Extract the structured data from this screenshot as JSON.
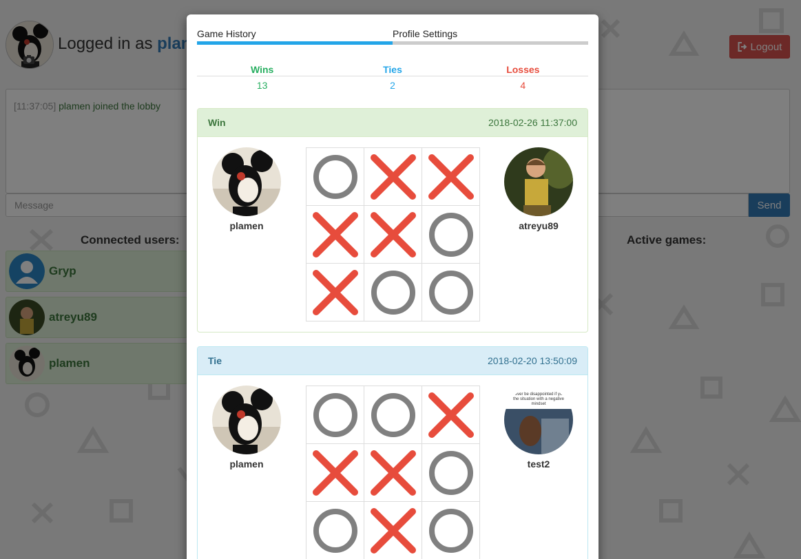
{
  "header": {
    "logged_prefix": "Logged in as",
    "username": "plam",
    "logout_label": "Logout"
  },
  "chat": {
    "time": "[11:37:05]",
    "message": "plamen joined the lobby"
  },
  "message_input": {
    "placeholder": "Message"
  },
  "send_label": "Send",
  "connected_users": {
    "title": "Connected users:",
    "users": [
      {
        "name": "Gryp"
      },
      {
        "name": "atreyu89"
      },
      {
        "name": "plamen"
      }
    ]
  },
  "active_games": {
    "title": "Active games:"
  },
  "modal": {
    "tabs": [
      {
        "label": "Game History",
        "active": true
      },
      {
        "label": "Profile Settings",
        "active": false
      }
    ],
    "stats": {
      "wins_label": "Wins",
      "ties_label": "Ties",
      "losses_label": "Losses",
      "wins": "13",
      "ties": "2",
      "losses": "4"
    },
    "games": [
      {
        "result": "Win",
        "date": "2018-02-26 11:37:00",
        "player1": "plamen",
        "player2": "atreyu89",
        "board": [
          "O",
          "X",
          "X",
          "X",
          "X",
          "O",
          "X",
          "O",
          "O"
        ]
      },
      {
        "result": "Tie",
        "date": "2018-02-20 13:50:09",
        "player1": "plamen",
        "player2": "test2",
        "player2_avatar_caption": "never be disappointed if you ... the situation with a negative ... mindset",
        "board": [
          "O",
          "O",
          "X",
          "X",
          "X",
          "O",
          "O",
          "X",
          "O"
        ]
      }
    ]
  },
  "colors": {
    "x_mark": "#e74c3c",
    "o_mark": "#808080",
    "win": "#27ae60",
    "tie": "#23a5e8",
    "loss": "#e74c3c"
  },
  "icons": {
    "logout": "logout-icon",
    "camera": "camera-icon"
  }
}
